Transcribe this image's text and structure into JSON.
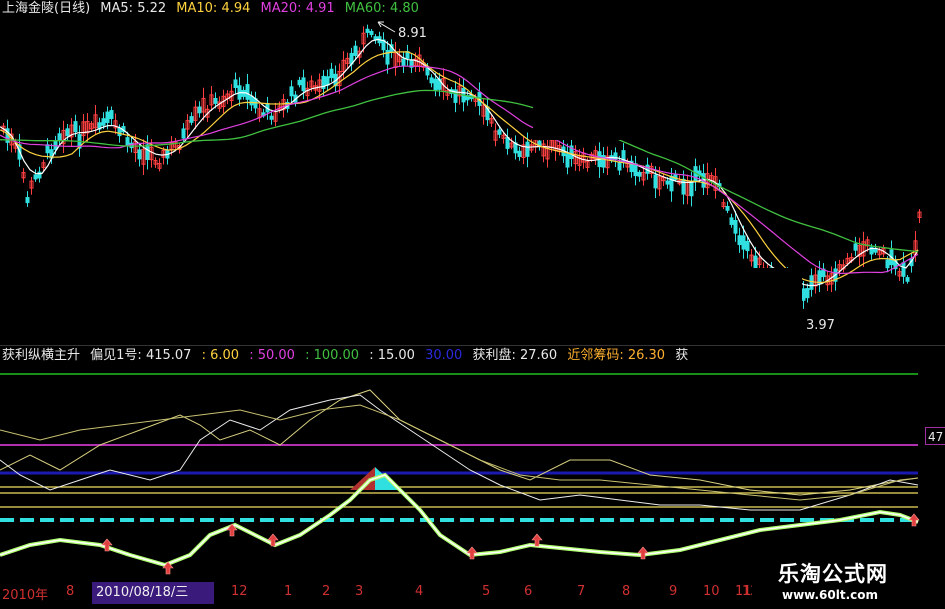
{
  "price_header": {
    "title": "上海金陵(日线)",
    "ma5": "MA5: 5.22",
    "ma10": "MA10: 4.94",
    "ma20": "MA20: 4.91",
    "ma60": "MA60: 4.80"
  },
  "price_labels": {
    "high": "8.91",
    "low": "3.97"
  },
  "indicator_header": {
    "name": "获利纵横主升",
    "params": "偏见1号: 415.07",
    "p1": ": 6.00",
    "p2": ": 50.00",
    "p3": ": 100.00",
    "p4": ": 15.00",
    "p5": "30.00",
    "profit": "获利盘: 27.60",
    "chips": "近邻筹码: 26.30",
    "extra": "获"
  },
  "right_value": "47",
  "axis": {
    "ticks": [
      "2010年",
      "8",
      "12",
      "1",
      "2",
      "3",
      "4",
      "5",
      "6",
      "7",
      "8",
      "9",
      "10",
      "11",
      "12"
    ],
    "cursor_date": "2010/08/18/三"
  },
  "watermark": {
    "title": "乐淘公式网",
    "url": "www.60lt.com"
  },
  "colors": {
    "up": "#ff4040",
    "down": "#30e0e0",
    "ma5": "#ffffff",
    "ma10": "#ffd23f",
    "ma20": "#e040e0",
    "ma60": "#40c040",
    "bg": "#000000"
  },
  "chart_data": {
    "type": "line",
    "series": [
      {
        "name": "MA5",
        "value": 5.22
      },
      {
        "name": "MA10",
        "value": 4.94
      },
      {
        "name": "MA20",
        "value": 4.91
      },
      {
        "name": "MA60",
        "value": 4.8
      }
    ],
    "price_high": 8.91,
    "price_low": 3.97
  }
}
